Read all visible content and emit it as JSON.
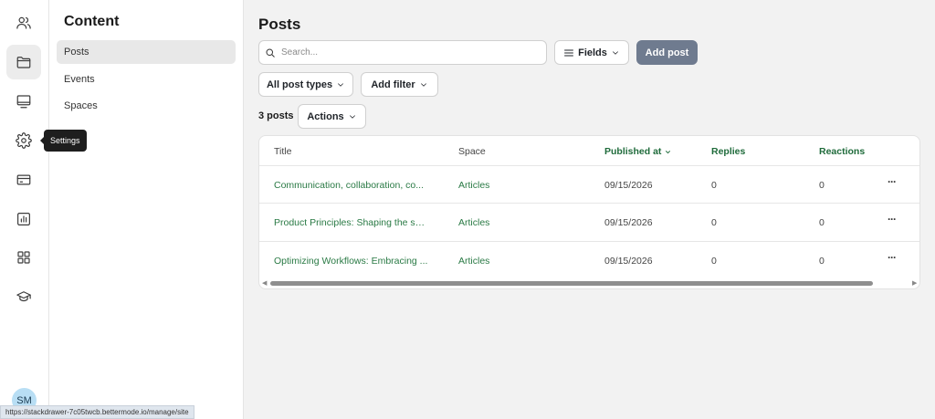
{
  "rail": {
    "avatar_initials": "SM"
  },
  "tooltip": "Settings",
  "panel": {
    "title": "Content",
    "items": [
      {
        "label": "Posts"
      },
      {
        "label": "Events"
      },
      {
        "label": "Spaces"
      }
    ]
  },
  "main": {
    "title": "Posts",
    "search_placeholder": "Search...",
    "fields_label": "Fields",
    "add_post_label": "Add post",
    "post_types_label": "All post types",
    "add_filter_label": "Add filter",
    "count_label": "3 posts",
    "actions_label": "Actions"
  },
  "table": {
    "columns": [
      "Title",
      "Space",
      "Published at",
      "Replies",
      "Reactions"
    ],
    "rows": [
      {
        "title": "Communication, collaboration, co...",
        "space": "Articles",
        "published": "09/15/2026",
        "replies": "0",
        "reactions": "0",
        "more": "···"
      },
      {
        "title": "Product Principles: Shaping the sol...",
        "space": "Articles",
        "published": "09/15/2026",
        "replies": "0",
        "reactions": "0",
        "more": "···"
      },
      {
        "title": "Optimizing Workflows: Embracing ...",
        "space": "Articles",
        "published": "09/15/2026",
        "replies": "0",
        "reactions": "0",
        "more": "···"
      }
    ]
  },
  "statusbar": "https://stackdrawer-7c05twcb.bettermode.io/manage/site",
  "colors": {
    "accent_green": "#2a7a45",
    "primary_button": "#6f7b8f",
    "tooltip_bg": "#1e1e1e"
  }
}
